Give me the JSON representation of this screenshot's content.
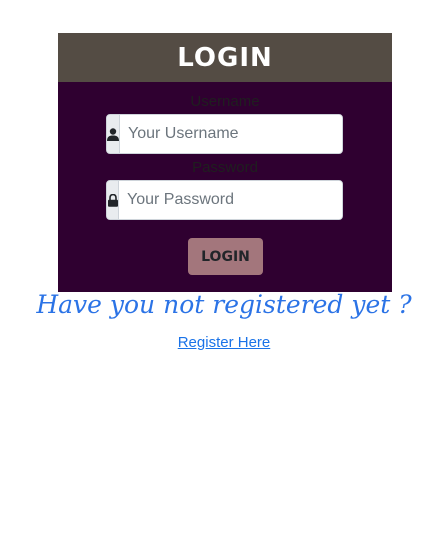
{
  "header": {
    "title": "LOGIN"
  },
  "form": {
    "username_label": "Username",
    "username_placeholder": "Your Username",
    "password_label": "Password",
    "password_placeholder": "Your Password",
    "submit_label": "LOGIN"
  },
  "icons": {
    "username_icon": "user-icon",
    "password_icon": "lock-icon"
  },
  "footer": {
    "prompt": "Have you not registered yet ?",
    "register_link": "Register Here"
  },
  "colors": {
    "header_bg": "#544c44",
    "card_bg": "#2f0030",
    "button_bg": "#a3767c",
    "prompt_color": "#2b73e6",
    "link_color": "#1a73e8"
  }
}
